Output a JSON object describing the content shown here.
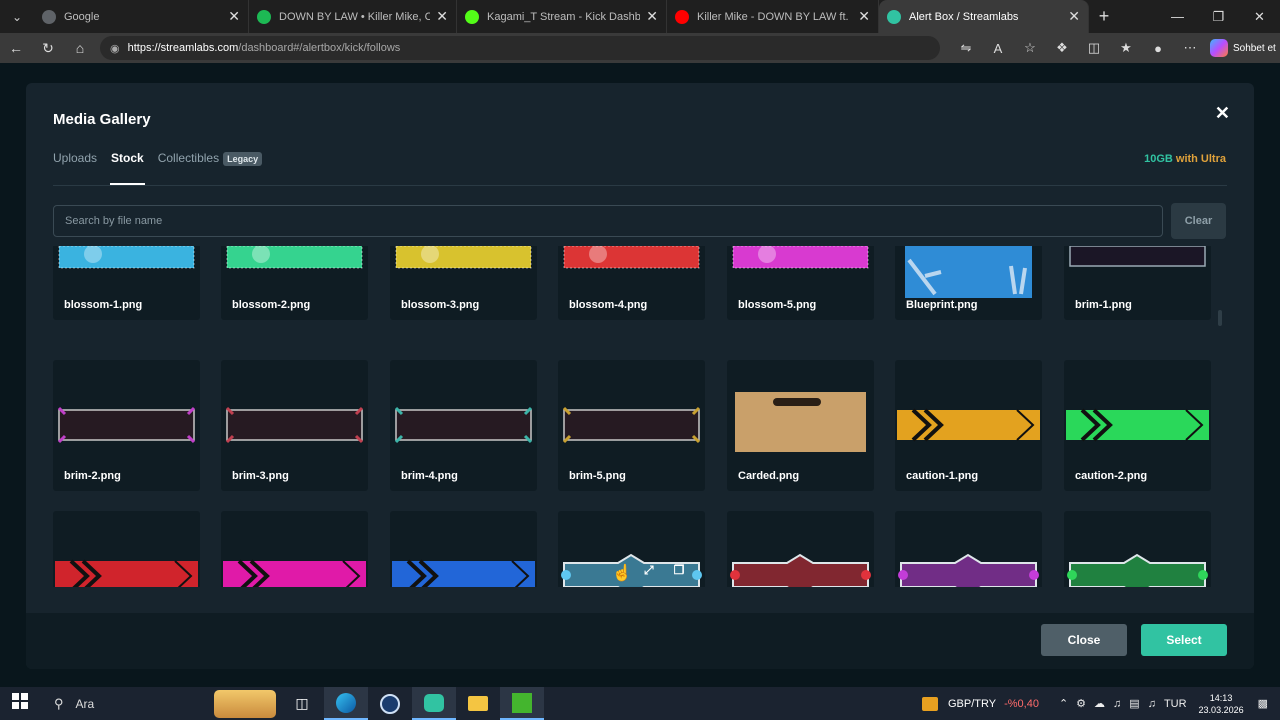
{
  "browser": {
    "tabs": [
      {
        "title": "Google",
        "fav": "google-icon",
        "color": "#5f6368"
      },
      {
        "title": "DOWN BY LAW • Killer Mike, Cee",
        "fav": "spotify-icon",
        "color": "#1db954"
      },
      {
        "title": "Kagami_T Stream - Kick Dashboar",
        "fav": "kick-icon",
        "color": "#53fc18"
      },
      {
        "title": "Killer Mike - DOWN BY LAW ft. Ce",
        "fav": "youtube-icon",
        "color": "#ff0000"
      },
      {
        "title": "Alert Box / Streamlabs",
        "fav": "streamlabs-icon",
        "color": "#31c3a2"
      }
    ],
    "url_host": "https://streamlabs.com",
    "url_path": "/dashboard#/alertbox/kick/follows",
    "copilot_label": "Sohbet et"
  },
  "modal": {
    "title": "Media Gallery",
    "close_symbol": "✕",
    "tabs": [
      {
        "label": "Uploads"
      },
      {
        "label": "Stock"
      },
      {
        "label": "Collectibles"
      }
    ],
    "legacy_badge": "Legacy",
    "storage_size": "10GB",
    "storage_plan": " with Ultra",
    "search_placeholder": "Search by file name",
    "clear_label": "Clear",
    "close_label": "Close",
    "select_label": "Select",
    "files": [
      {
        "name": "blossom-1.png",
        "kind": "blossom",
        "color": "#3ab3e0"
      },
      {
        "name": "blossom-2.png",
        "kind": "blossom",
        "color": "#35d38f"
      },
      {
        "name": "blossom-3.png",
        "kind": "blossom",
        "color": "#d8c22e"
      },
      {
        "name": "blossom-4.png",
        "kind": "blossom",
        "color": "#dc3535"
      },
      {
        "name": "blossom-5.png",
        "kind": "blossom",
        "color": "#d83ad0"
      },
      {
        "name": "Blueprint.png",
        "kind": "blueprint",
        "color": "#2f8cd6"
      },
      {
        "name": "brim-1.png",
        "kind": "brimtop",
        "color": "#9aa9b4"
      },
      {
        "name": "brim-2.png",
        "kind": "brim",
        "color": "#c040c8"
      },
      {
        "name": "brim-3.png",
        "kind": "brim",
        "color": "#c04050"
      },
      {
        "name": "brim-4.png",
        "kind": "brim",
        "color": "#3cb4a8"
      },
      {
        "name": "brim-5.png",
        "kind": "brim",
        "color": "#c8a030"
      },
      {
        "name": "Carded.png",
        "kind": "carded",
        "color": "#c9a06a"
      },
      {
        "name": "caution-1.png",
        "kind": "caution",
        "color": "#e3a21f"
      },
      {
        "name": "caution-2.png",
        "kind": "caution",
        "color": "#2ad85a"
      },
      {
        "name": "",
        "kind": "caution",
        "color": "#d0242c"
      },
      {
        "name": "",
        "kind": "caution",
        "color": "#e01aa8"
      },
      {
        "name": "",
        "kind": "caution",
        "color": "#2266d8"
      },
      {
        "name": "",
        "kind": "chevron",
        "color": "#5ec6f0"
      },
      {
        "name": "",
        "kind": "chevron",
        "color": "#e0323c"
      },
      {
        "name": "",
        "kind": "chevron",
        "color": "#c33cd8"
      },
      {
        "name": "",
        "kind": "chevron",
        "color": "#2fd65a"
      }
    ]
  },
  "taskbar": {
    "search_label": "Ara",
    "fx_label": "GBP/TRY",
    "fx_change": "-%0,40",
    "lang": "TUR",
    "time": "14:13",
    "date": "23.03.2026"
  }
}
